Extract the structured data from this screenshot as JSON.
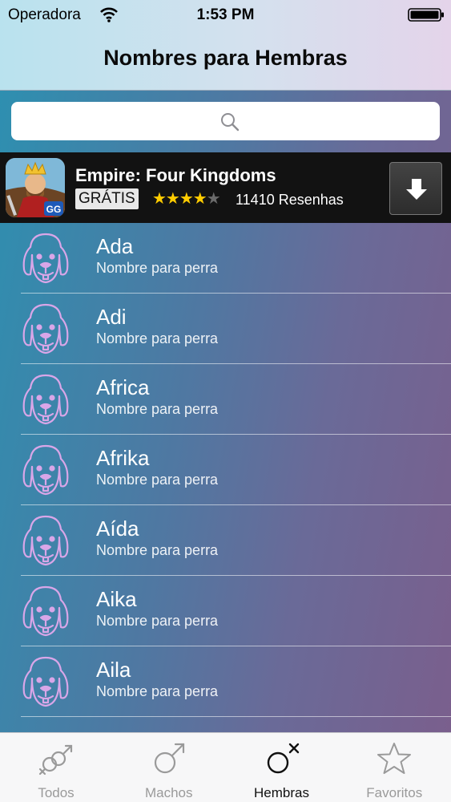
{
  "status_bar": {
    "carrier": "Operadora",
    "time": "1:53 PM"
  },
  "header": {
    "title": "Nombres para Hembras"
  },
  "search": {
    "placeholder": ""
  },
  "ad": {
    "title": "Empire: Four Kingdoms",
    "badge": "GRÁTIS",
    "rating": 4,
    "stars_on": "★★★★",
    "stars_off": "★",
    "reviews": "11410 Resenhas",
    "app_icon": "empire-game-icon",
    "download_icon": "download-arrow-icon"
  },
  "list": {
    "items": [
      {
        "name": "Ada",
        "subtitle": "Nombre para perra"
      },
      {
        "name": "Adi",
        "subtitle": "Nombre para perra"
      },
      {
        "name": "Africa",
        "subtitle": "Nombre para perra"
      },
      {
        "name": "Afrika",
        "subtitle": "Nombre para perra"
      },
      {
        "name": "Aída",
        "subtitle": "Nombre para perra"
      },
      {
        "name": "Aika",
        "subtitle": "Nombre para perra"
      },
      {
        "name": "Aila",
        "subtitle": "Nombre para perra"
      }
    ]
  },
  "tabs": [
    {
      "label": "Todos",
      "icon": "male-female-icon",
      "active": false
    },
    {
      "label": "Machos",
      "icon": "male-symbol-icon",
      "active": false
    },
    {
      "label": "Hembras",
      "icon": "female-symbol-icon",
      "active": true
    },
    {
      "label": "Favoritos",
      "icon": "star-icon",
      "active": false
    }
  ],
  "colors": {
    "accent_active": "#111111",
    "tab_inactive": "#9a9a9a",
    "dog_icon": "#d9a6e8",
    "star": "#ffcc00"
  }
}
